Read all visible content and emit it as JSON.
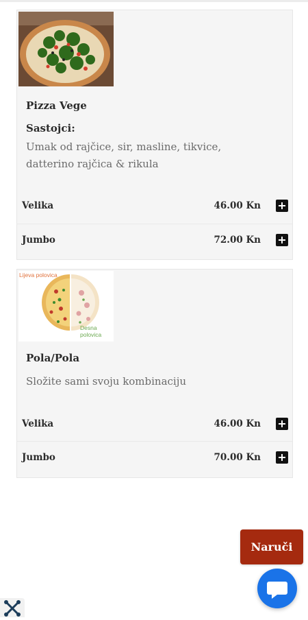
{
  "colors": {
    "order_button": "#a52a0f",
    "chat_button": "#1a73e8",
    "card_bg": "#f5f5f5"
  },
  "products": [
    {
      "name": "Pizza Vege",
      "ingredients_title": "Sastojci:",
      "description": "Umak od rajčice, sir, masline, tikvice, datterino rajčica & rikula",
      "image_icon": "pizza-vege-photo",
      "sizes": [
        {
          "label": "Velika",
          "price": "46.00 Kn"
        },
        {
          "label": "Jumbo",
          "price": "72.00 Kn"
        }
      ]
    },
    {
      "name": "Pola/Pola",
      "description": "Složite sami svoju kombinaciju",
      "image_icon": "half-half-pizza-illustration",
      "image_labels": {
        "left": "Lijeva polovica",
        "right": "Desna polovica"
      },
      "sizes": [
        {
          "label": "Velika",
          "price": "46.00 Kn"
        },
        {
          "label": "Jumbo",
          "price": "70.00 Kn"
        }
      ]
    }
  ],
  "order_button": {
    "label": "Naruči"
  },
  "chat_button": {
    "icon": "chat-bubble-icon"
  },
  "footer_logo": {
    "icon": "joomla-icon"
  }
}
